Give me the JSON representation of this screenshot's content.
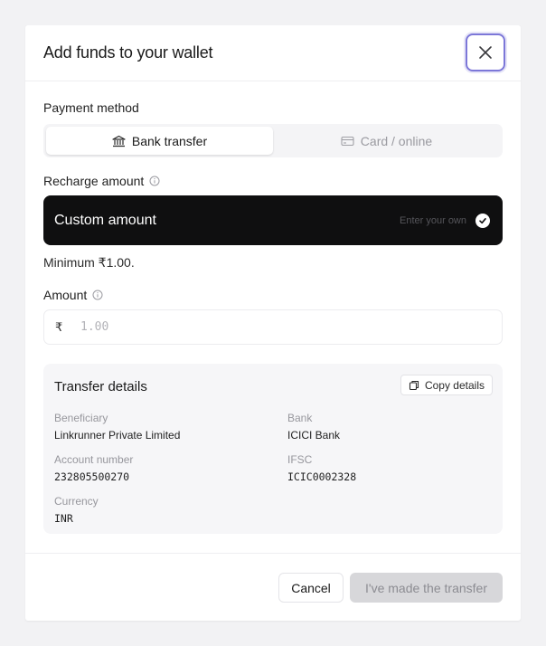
{
  "modal": {
    "title": "Add funds to your wallet",
    "close_icon": "close-icon"
  },
  "payment_method": {
    "label": "Payment method",
    "tabs": [
      {
        "label": "Bank transfer",
        "icon": "bank-icon",
        "active": true
      },
      {
        "label": "Card / online",
        "icon": "card-icon",
        "active": false
      }
    ]
  },
  "recharge": {
    "label": "Recharge amount",
    "info_icon": "info-icon",
    "option_label": "Custom amount",
    "option_hint": "Enter your own",
    "selected": true
  },
  "minimum_text": "Minimum ₹1.00.",
  "amount": {
    "label": "Amount",
    "currency_symbol": "₹",
    "placeholder": "1.00",
    "value": ""
  },
  "transfer_details": {
    "title": "Transfer details",
    "copy_label": "Copy details",
    "fields": {
      "beneficiary": {
        "label": "Beneficiary",
        "value": "Linkrunner Private Limited"
      },
      "bank": {
        "label": "Bank",
        "value": "ICICI Bank"
      },
      "account_number": {
        "label": "Account number",
        "value": "232805500270"
      },
      "ifsc": {
        "label": "IFSC",
        "value": "ICIC0002328"
      },
      "currency": {
        "label": "Currency",
        "value": "INR"
      }
    }
  },
  "footer": {
    "cancel_label": "Cancel",
    "confirm_label": "I've made the transfer",
    "confirm_disabled": true
  },
  "colors": {
    "accent_focus": "#7c77d8",
    "selected_card_bg": "#0f0f10",
    "disabled_button_bg": "#d7d7da"
  }
}
